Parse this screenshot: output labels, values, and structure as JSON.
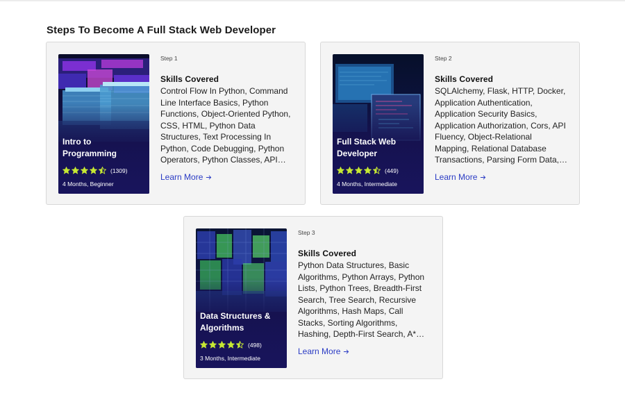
{
  "section": {
    "title": "Steps To Become A Full Stack Web Developer"
  },
  "cards": [
    {
      "step": "Step 1",
      "thumb_title": "Intro to Programming",
      "rating": 4.5,
      "rating_count": "(1309)",
      "meta": "4 Months, Beginner",
      "skills_heading": "Skills Covered",
      "skills": "Control Flow In Python, Command Line Interface Basics, Python Functions, Object-Oriented Python, CSS, HTML, Python Data Structures, Text Processing In Python, Code Debugging, Python Operators, Python Classes, API Requests, Python Loops, JavaScript",
      "learn_more": "Learn More",
      "art_icon": "data-blocks-image"
    },
    {
      "step": "Step 2",
      "thumb_title": "Full Stack Web Developer",
      "rating": 4.5,
      "rating_count": "(449)",
      "meta": "4 Months, Intermediate",
      "skills_heading": "Skills Covered",
      "skills": "SQLAlchemy, Flask, HTTP, Docker, Application Authentication, Application Security Basics, Application Authorization, Cors, API Fluency, Object-Relational Mapping, Relational Database Transactions, Parsing Form Data, Kubernetes, Git, Database Migrations",
      "learn_more": "Learn More",
      "art_icon": "screens-image"
    },
    {
      "step": "Step 3",
      "thumb_title": "Data Structures & Algorithms",
      "rating": 4.5,
      "rating_count": "(498)",
      "meta": "3 Months, Intermediate",
      "skills_heading": "Skills Covered",
      "skills": "Python Data Structures, Basic Algorithms, Python Arrays, Python Lists, Python Trees, Breadth-First Search, Tree Search, Recursive Algorithms, Hash Maps, Call Stacks, Sorting Algorithms, Hashing, Depth-First Search, A* Search Algorithm, Dynamic Programming",
      "learn_more": "Learn More",
      "art_icon": "cubes-image"
    }
  ],
  "colors": {
    "star": "#c6e833",
    "link": "#2a3bc4",
    "card_bg": "#f4f4f4",
    "thumb_navy": "#1b1760"
  }
}
